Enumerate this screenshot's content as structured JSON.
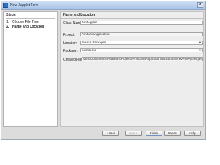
{
  "window": {
    "title": "New JApplet Form",
    "close_glyph": "✕"
  },
  "steps": {
    "header": "Steps",
    "items": [
      {
        "num": "1.",
        "label": "Choose File Type"
      },
      {
        "num": "2.",
        "label": "Name and Location"
      }
    ]
  },
  "main": {
    "header": "Name and Location",
    "class_name": {
      "label": "Class Name:",
      "value": "AmitApplet"
    },
    "project": {
      "label": "Project:",
      "value": "AmitJavaApplication"
    },
    "location": {
      "label": "Location:",
      "value": "Source Packages"
    },
    "package": {
      "label": "Package:",
      "value": "tutorial.me"
    },
    "created_file": {
      "label": "Created File:",
      "value": "\\amit\\Documents\\NetBeansProjects\\AmitJavaApplication\\src\\tutorial\\me\\AmitApplet.java"
    }
  },
  "buttons": {
    "back": "< Back",
    "next": "Next >",
    "finish": "Finish",
    "cancel": "Cancel",
    "help": "Help"
  }
}
